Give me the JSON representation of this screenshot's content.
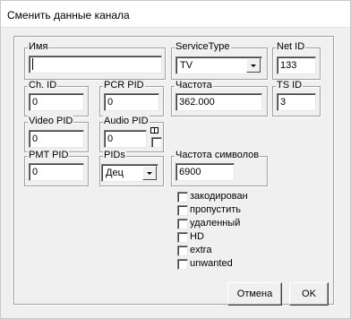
{
  "window": {
    "title": "Сменить данные канала"
  },
  "fields": {
    "name": {
      "label": "Имя",
      "value": ""
    },
    "service_type": {
      "label": "ServiceType",
      "value": "TV"
    },
    "net_id": {
      "label": "Net ID",
      "value": "133"
    },
    "ch_id": {
      "label": "Ch. ID",
      "value": "0"
    },
    "pcr_pid": {
      "label": "PCR PID",
      "value": "0"
    },
    "frequency": {
      "label": "Частота",
      "value": "362.000"
    },
    "ts_id": {
      "label": "TS ID",
      "value": "3"
    },
    "video_pid": {
      "label": "Video PID",
      "value": "0"
    },
    "audio_pid": {
      "label": "Audio PID",
      "value": "0"
    },
    "pmt_pid": {
      "label": "PMT PID",
      "value": "0"
    },
    "pids": {
      "label": "PIDs",
      "value": "Дец"
    },
    "symbol_rate": {
      "label": "Частота символов",
      "value": "6900"
    }
  },
  "flags": [
    {
      "label": "закодирован",
      "checked": false
    },
    {
      "label": "пропустить",
      "checked": false
    },
    {
      "label": "удаленный",
      "checked": false
    },
    {
      "label": "HD",
      "checked": false
    },
    {
      "label": "extra",
      "checked": false
    },
    {
      "label": "unwanted",
      "checked": false
    }
  ],
  "buttons": {
    "cancel": "Отмена",
    "ok": "OK"
  }
}
